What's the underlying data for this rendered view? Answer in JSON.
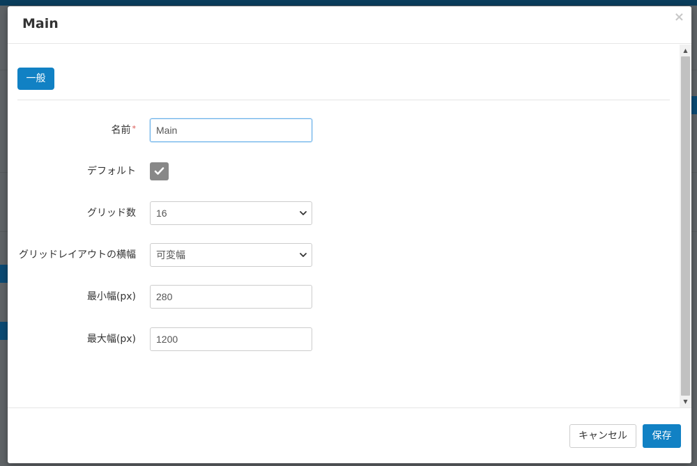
{
  "modal": {
    "title": "Main",
    "close_glyph": "×",
    "tabs": [
      {
        "label": "一般",
        "active": true
      }
    ],
    "fields": {
      "name": {
        "label": "名前",
        "required_mark": "*",
        "value": "Main"
      },
      "default": {
        "label": "デフォルト",
        "checked": true
      },
      "grid_count": {
        "label": "グリッド数",
        "value": "16"
      },
      "grid_layout_width": {
        "label": "グリッドレイアウトの横幅",
        "value": "可変幅"
      },
      "min_width": {
        "label": "最小幅(px)",
        "value": "280"
      },
      "max_width": {
        "label": "最大幅(px)",
        "value": "1200"
      }
    },
    "footer": {
      "cancel_label": "キャンセル",
      "save_label": "保存"
    }
  },
  "colors": {
    "primary": "#1181c4",
    "checkbox": "#888888",
    "required": "#d9534f",
    "focus_border": "#66afe9"
  },
  "icons": {
    "close": "close-icon",
    "checkbox": "check-icon",
    "select": "chevron-down-icon",
    "scroll_up": "scroll-up-icon",
    "scroll_down": "scroll-down-icon"
  }
}
